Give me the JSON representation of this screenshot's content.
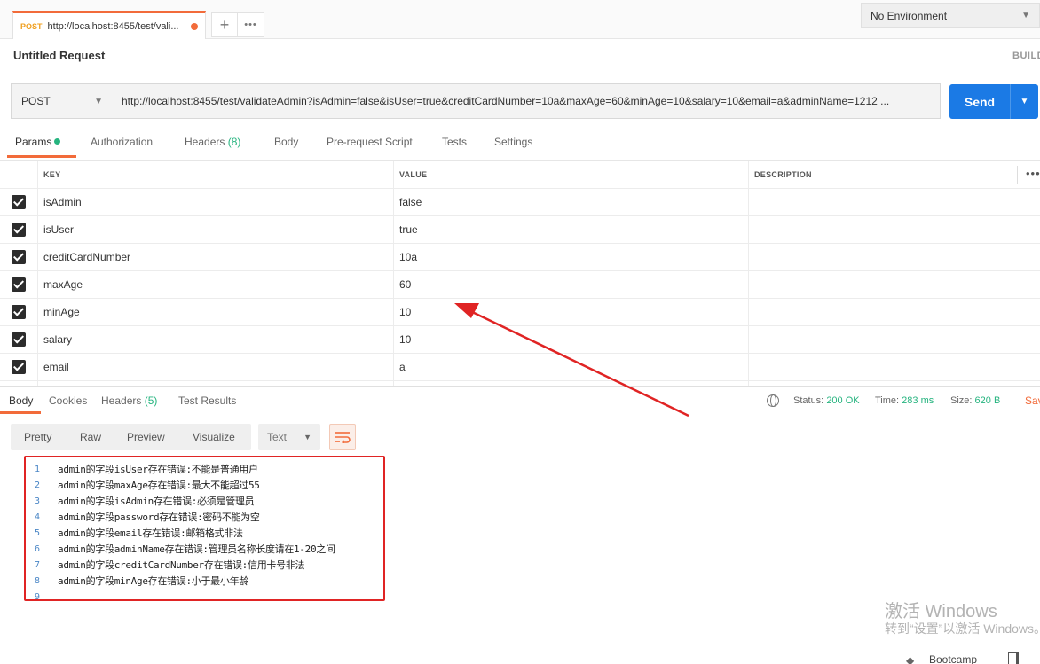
{
  "tab": {
    "method": "POST",
    "url": "http://localhost:8455/test/vali..."
  },
  "environment": {
    "selected": "No Environment"
  },
  "request_title": "Untitled Request",
  "build_label": "BUILD",
  "request": {
    "method": "POST",
    "url": "http://localhost:8455/test/validateAdmin?isAdmin=false&isUser=true&creditCardNumber=10a&maxAge=60&minAge=10&salary=10&email=a&adminName=1212 ...",
    "send_label": "Send"
  },
  "request_tabs": [
    {
      "label": "Params",
      "count": ""
    },
    {
      "label": "Authorization",
      "count": ""
    },
    {
      "label": "Headers",
      "count": "(8)"
    },
    {
      "label": "Body",
      "count": ""
    },
    {
      "label": "Pre-request Script",
      "count": ""
    },
    {
      "label": "Tests",
      "count": ""
    },
    {
      "label": "Settings",
      "count": ""
    }
  ],
  "params": {
    "headers": {
      "key": "KEY",
      "value": "VALUE",
      "description": "DESCRIPTION"
    },
    "rows": [
      {
        "key": "isAdmin",
        "value": "false",
        "checked": true
      },
      {
        "key": "isUser",
        "value": "true",
        "checked": true
      },
      {
        "key": "creditCardNumber",
        "value": "10a",
        "checked": true
      },
      {
        "key": "maxAge",
        "value": "60",
        "checked": true
      },
      {
        "key": "minAge",
        "value": "10",
        "checked": true
      },
      {
        "key": "salary",
        "value": "10",
        "checked": true
      },
      {
        "key": "email",
        "value": "a",
        "checked": true
      }
    ]
  },
  "response_tabs": [
    {
      "label": "Body",
      "count": ""
    },
    {
      "label": "Cookies",
      "count": ""
    },
    {
      "label": "Headers",
      "count": "(5)"
    },
    {
      "label": "Test Results",
      "count": ""
    }
  ],
  "response_status": {
    "status_label": "Status:",
    "status": "200 OK",
    "time_label": "Time:",
    "time": "283 ms",
    "size_label": "Size:",
    "size": "620 B",
    "save_label": "Sav"
  },
  "format_buttons": [
    "Pretty",
    "Raw",
    "Preview",
    "Visualize"
  ],
  "format_select": "Text",
  "response_body": [
    {
      "n": "1",
      "text": "admin的字段isUser存在错误:不能是普通用户"
    },
    {
      "n": "2",
      "text": "admin的字段maxAge存在错误:最大不能超过55"
    },
    {
      "n": "3",
      "text": "admin的字段isAdmin存在错误:必须是管理员"
    },
    {
      "n": "4",
      "text": "admin的字段password存在错误:密码不能为空"
    },
    {
      "n": "5",
      "text": "admin的字段email存在错误:邮箱格式非法"
    },
    {
      "n": "6",
      "text": "admin的字段adminName存在错误:管理员名称长度请在1-20之间"
    },
    {
      "n": "7",
      "text": "admin的字段creditCardNumber存在错误:信用卡号非法"
    },
    {
      "n": "8",
      "text": "admin的字段minAge存在错误:小于最小年龄"
    },
    {
      "n": "9",
      "text": ""
    }
  ],
  "watermark": {
    "line1": "激活 Windows",
    "line2": "转到“设置”以激活 Windows。"
  },
  "footer": {
    "bootcamp": "Bootcamp"
  },
  "colors": {
    "accent": "#f26b3a",
    "send": "#1b7ae5",
    "success": "#26b47f",
    "annotation": "#e02424"
  }
}
